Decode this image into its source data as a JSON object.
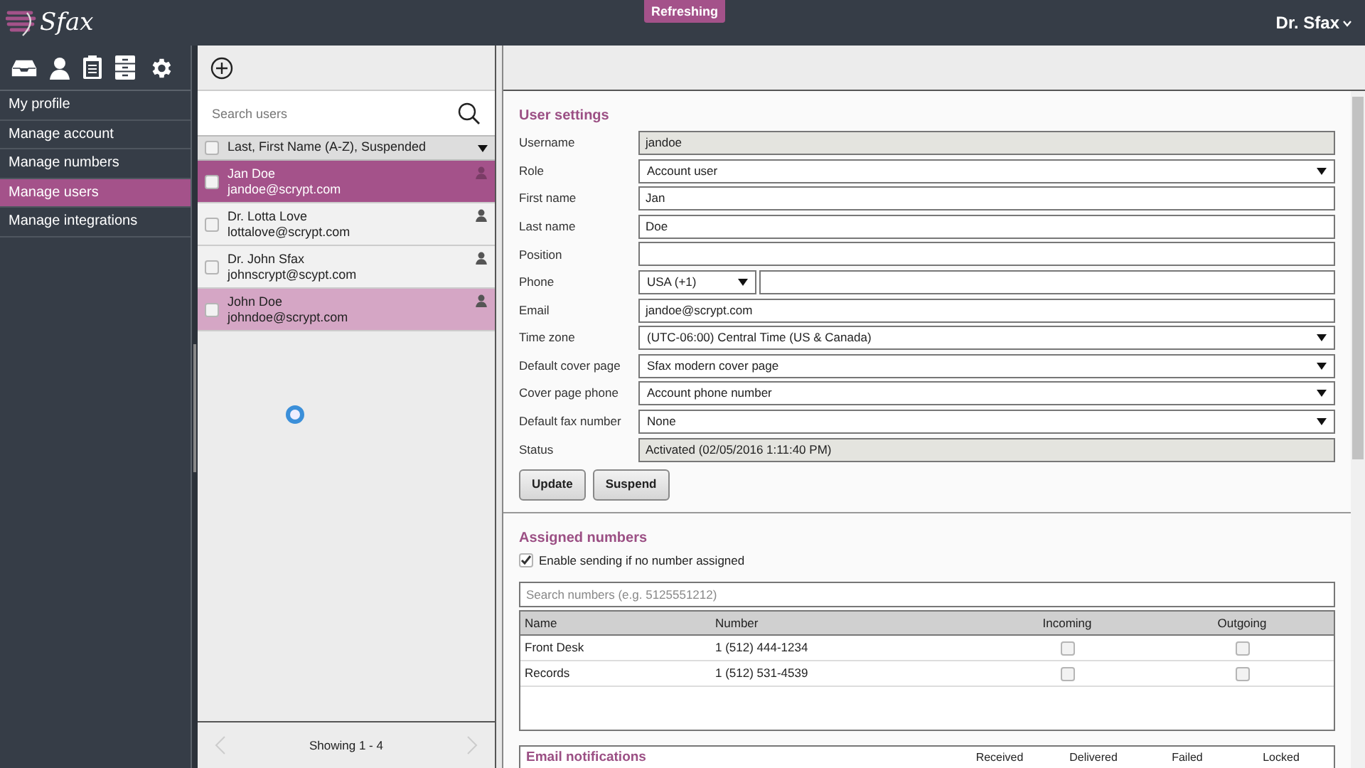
{
  "header": {
    "logo": "Sfax",
    "badge": "Refreshing",
    "user_menu": "Dr. Sfax"
  },
  "sidebar": {
    "items": [
      {
        "label": "My profile",
        "selected": false
      },
      {
        "label": "Manage account",
        "selected": false
      },
      {
        "label": "Manage numbers",
        "selected": false
      },
      {
        "label": "Manage users",
        "selected": true
      },
      {
        "label": "Manage integrations",
        "selected": false
      }
    ]
  },
  "users": {
    "search_placeholder": "Search users",
    "sort": "Last, First Name (A-Z), Suspended",
    "select_all": false,
    "rows": [
      {
        "name": "Jan Doe",
        "email": "jandoe@scrypt.com",
        "selected": true,
        "suspended": false,
        "checked": false
      },
      {
        "name": "Dr. Lotta Love",
        "email": "lottalove@scrypt.com",
        "selected": false,
        "suspended": false,
        "checked": false
      },
      {
        "name": "Dr. John Sfax",
        "email": "johnscrypt@scypt.com",
        "selected": false,
        "suspended": false,
        "checked": false
      },
      {
        "name": "John Doe",
        "email": "johndoe@scrypt.com",
        "selected": false,
        "suspended": true,
        "checked": false
      }
    ],
    "footer": "Showing 1 - 4"
  },
  "user_settings": {
    "title": "User settings",
    "fields": [
      {
        "label": "Username",
        "kind": "readonly",
        "value": "jandoe"
      },
      {
        "label": "Role",
        "kind": "select",
        "value": "Account user"
      },
      {
        "label": "First name",
        "kind": "text",
        "value": "Jan"
      },
      {
        "label": "Last name",
        "kind": "text",
        "value": "Doe"
      },
      {
        "label": "Position",
        "kind": "text"
      },
      {
        "label": "Phone",
        "kind": "phone",
        "value": "USA (+1)"
      },
      {
        "label": "Email",
        "kind": "text",
        "value": "jandoe@scrypt.com"
      },
      {
        "label": "Time zone",
        "kind": "select",
        "value": "(UTC-06:00) Central Time (US & Canada)"
      },
      {
        "label": "Default cover page",
        "kind": "select",
        "value": "Sfax modern cover page"
      },
      {
        "label": "Cover page phone",
        "kind": "select",
        "value": "Account phone number"
      },
      {
        "label": "Default fax number",
        "kind": "select",
        "value": "None"
      },
      {
        "label": "Status",
        "kind": "readonly",
        "value": "Activated (02/05/2016 1:11:40 PM)"
      }
    ],
    "buttons": [
      "Update",
      "Suspend"
    ]
  },
  "assigned_numbers": {
    "title": "Assigned numbers",
    "enable_sending": {
      "label": "Enable sending if no number assigned",
      "checked": true
    },
    "search_placeholder": "Search numbers (e.g. 5125551212)",
    "columns": [
      "Name",
      "Number",
      "Incoming",
      "Outgoing"
    ],
    "rows": [
      {
        "name": "Front Desk",
        "number": "1 (512) 444-1234",
        "incoming": false,
        "outgoing": false
      },
      {
        "name": "Records",
        "number": "1 (512) 531-4539",
        "incoming": false,
        "outgoing": false
      }
    ]
  },
  "email_notifications": {
    "title": "Email notifications",
    "columns": [
      "Received",
      "Delivered",
      "Failed",
      "Locked"
    ]
  }
}
